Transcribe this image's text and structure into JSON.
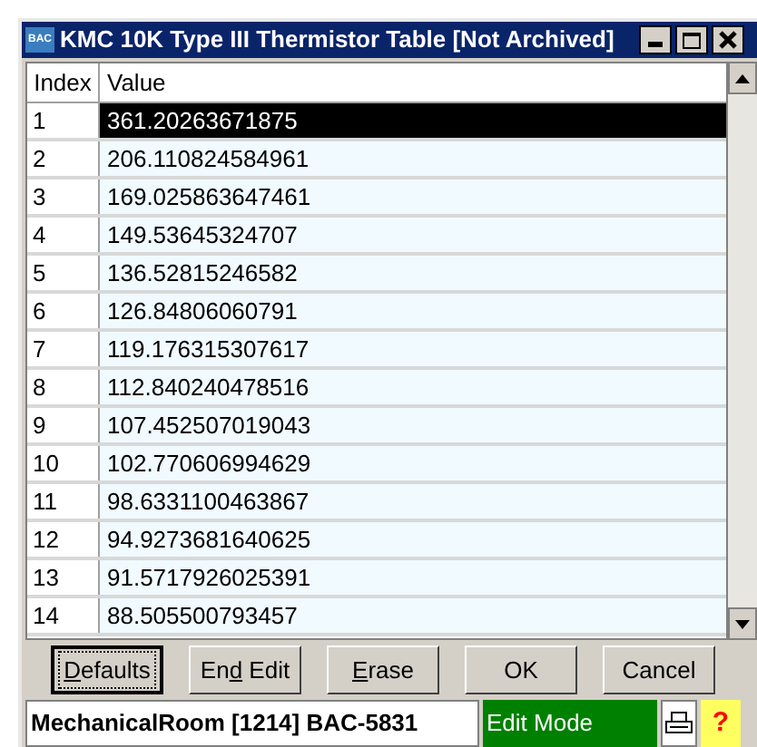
{
  "window": {
    "title": "KMC 10K Type III Thermistor Table [Not Archived]",
    "app_icon": "BAC"
  },
  "table": {
    "columns": [
      "Index",
      "Value"
    ],
    "rows": [
      {
        "index": "1",
        "value": "361.20263671875",
        "selected": true
      },
      {
        "index": "2",
        "value": "206.110824584961",
        "selected": false
      },
      {
        "index": "3",
        "value": "169.025863647461",
        "selected": false
      },
      {
        "index": "4",
        "value": "149.53645324707",
        "selected": false
      },
      {
        "index": "5",
        "value": "136.52815246582",
        "selected": false
      },
      {
        "index": "6",
        "value": "126.84806060791",
        "selected": false
      },
      {
        "index": "7",
        "value": "119.176315307617",
        "selected": false
      },
      {
        "index": "8",
        "value": "112.840240478516",
        "selected": false
      },
      {
        "index": "9",
        "value": "107.452507019043",
        "selected": false
      },
      {
        "index": "10",
        "value": "102.770606994629",
        "selected": false
      },
      {
        "index": "11",
        "value": "98.6331100463867",
        "selected": false
      },
      {
        "index": "12",
        "value": "94.9273681640625",
        "selected": false
      },
      {
        "index": "13",
        "value": "91.5717926025391",
        "selected": false
      },
      {
        "index": "14",
        "value": "88.505500793457",
        "selected": false
      }
    ]
  },
  "buttons": [
    {
      "parts": [
        {
          "text": "D",
          "underline": true
        },
        {
          "text": "efaults",
          "underline": false
        }
      ],
      "focused": true
    },
    {
      "parts": [
        {
          "text": "En",
          "underline": false
        },
        {
          "text": "d",
          "underline": true
        },
        {
          "text": " Edit",
          "underline": false
        }
      ],
      "focused": false
    },
    {
      "parts": [
        {
          "text": "E",
          "underline": true
        },
        {
          "text": "rase",
          "underline": false
        }
      ],
      "focused": false
    },
    {
      "parts": [
        {
          "text": "OK",
          "underline": false
        }
      ],
      "focused": false
    },
    {
      "parts": [
        {
          "text": "Cancel",
          "underline": false
        }
      ],
      "focused": false
    }
  ],
  "status_bar": {
    "location": "MechanicalRoom [1214] BAC-5831",
    "mode": "Edit Mode",
    "help_icon": "?"
  }
}
